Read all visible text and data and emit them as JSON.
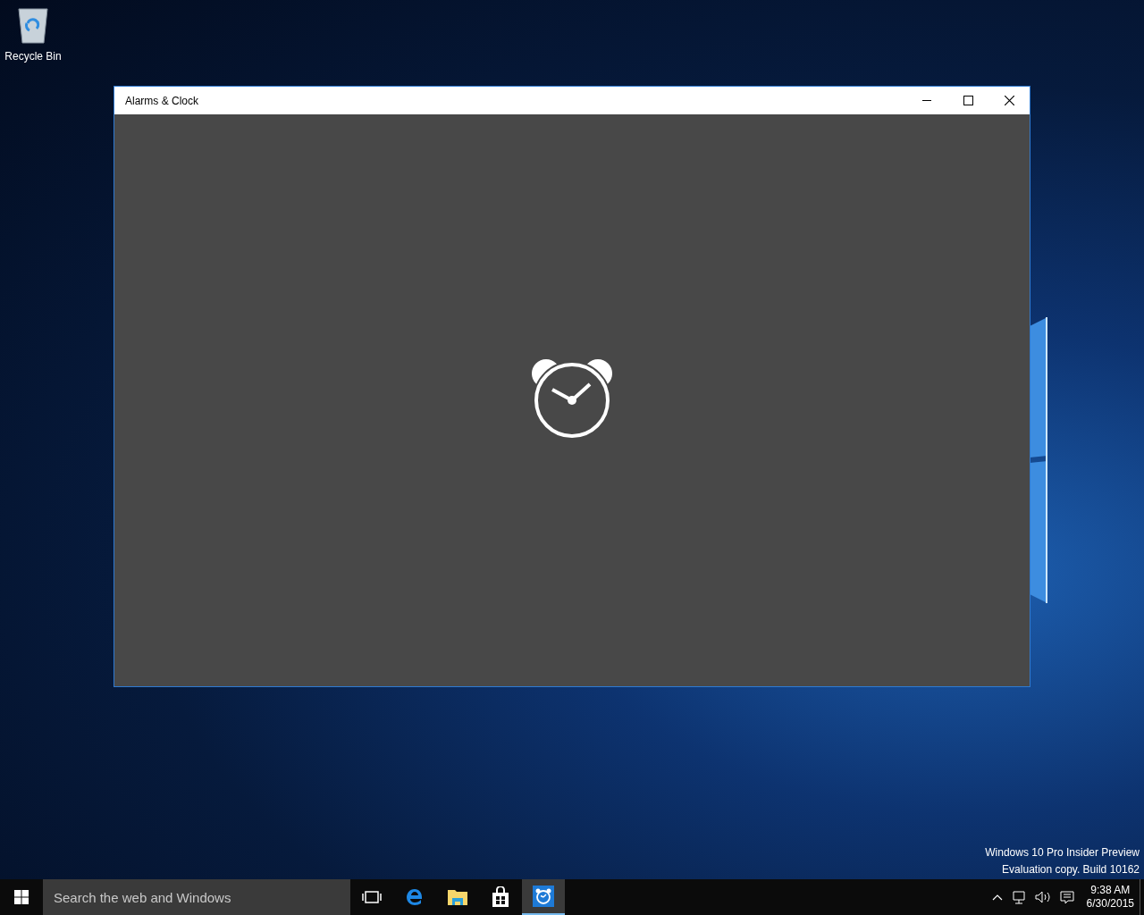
{
  "desktop": {
    "icons": [
      {
        "label": "Recycle Bin"
      }
    ],
    "build_info": [
      "Windows 10 Pro Insider Preview",
      "Evaluation copy. Build 10162"
    ]
  },
  "window": {
    "title": "Alarms & Clock"
  },
  "taskbar": {
    "search": {
      "placeholder": "Search the web and Windows"
    },
    "apps": [
      {
        "kind": "taskview",
        "selected": false
      },
      {
        "kind": "edge",
        "selected": false
      },
      {
        "kind": "explorer",
        "selected": false
      },
      {
        "kind": "store",
        "selected": false
      },
      {
        "kind": "alarms",
        "selected": true
      }
    ],
    "clock": {
      "time": "9:38 AM",
      "date": "6/30/2015"
    }
  }
}
